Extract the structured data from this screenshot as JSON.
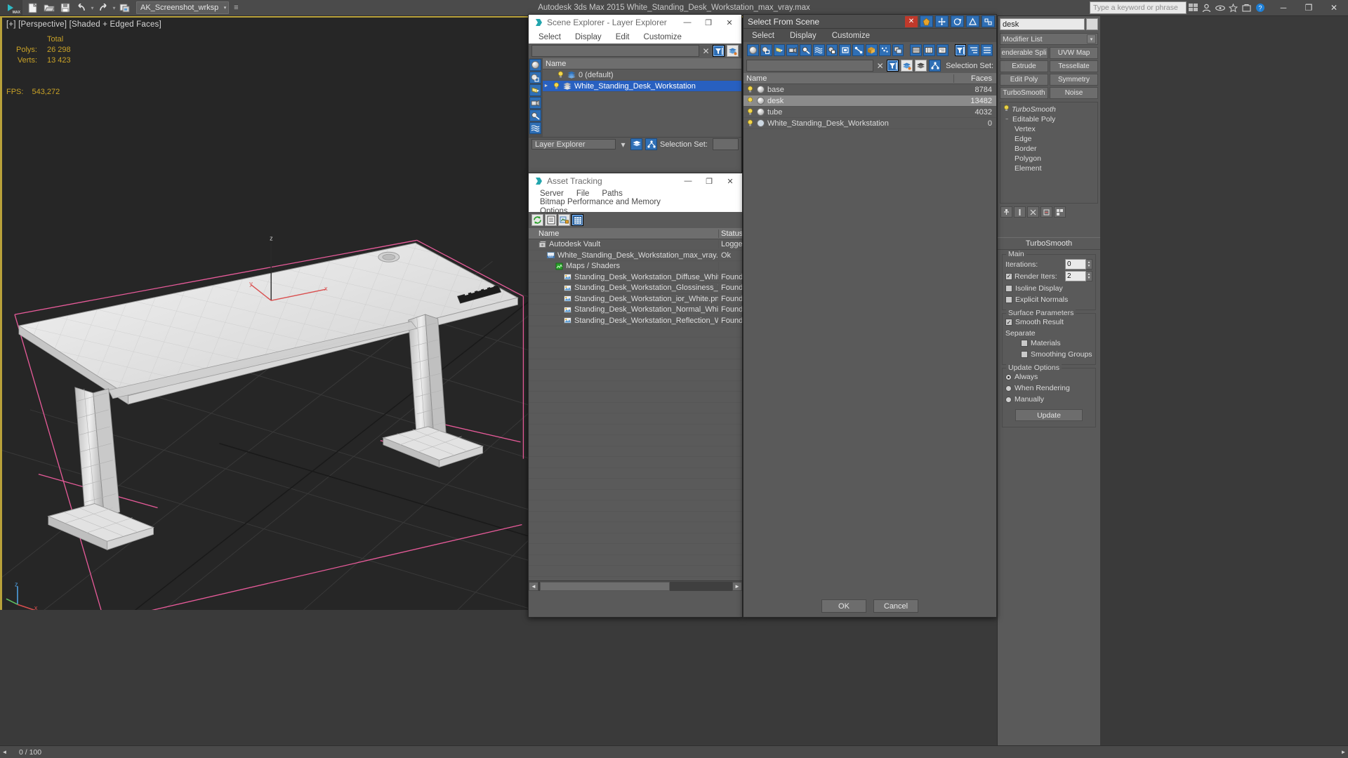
{
  "titlebar": {
    "logo_label": "MAX",
    "workspace": "AK_Screenshot_wrksp",
    "app_title": "Autodesk 3ds Max  2015      White_Standing_Desk_Workstation_max_vray.max",
    "search_placeholder": "Type a keyword or phrase",
    "quick_access": [
      {
        "name": "new-file-icon",
        "glyph": "⬜"
      },
      {
        "name": "open-file-icon",
        "glyph": "📂"
      },
      {
        "name": "save-file-icon",
        "glyph": "💾"
      },
      {
        "name": "undo-icon",
        "glyph": "↶"
      },
      {
        "name": "redo-icon",
        "glyph": "↷"
      },
      {
        "name": "project-folder-icon",
        "glyph": "🗂"
      }
    ],
    "window_buttons": [
      "─",
      "❐",
      "✕"
    ]
  },
  "viewport": {
    "label": "[+] [Perspective] [Shaded + Edged Faces]",
    "stats": {
      "header": "Total",
      "rows": [
        {
          "label": "Polys:",
          "value": "26 298"
        },
        {
          "label": "Verts:",
          "value": "13 423"
        }
      ],
      "fps_label": "FPS:",
      "fps_value": "543,272"
    }
  },
  "scene_explorer": {
    "title": "Scene Explorer - Layer Explorer",
    "menus": [
      "Select",
      "Display",
      "Edit",
      "Customize"
    ],
    "column_name": "Name",
    "rows": [
      {
        "name": "0 (default)",
        "selected": false,
        "expandable": false
      },
      {
        "name": "White_Standing_Desk_Workstation",
        "selected": true,
        "expandable": true
      }
    ],
    "footer_label": "Layer Explorer",
    "selection_set_label": "Selection Set:"
  },
  "asset_tracking": {
    "title": "Asset Tracking",
    "menus": [
      "Server",
      "File",
      "Paths",
      "Bitmap Performance and Memory",
      "Options"
    ],
    "columns": [
      "Name",
      "Status"
    ],
    "rows": [
      {
        "name": "Autodesk Vault",
        "status": "Logge",
        "icon": "vault-icon",
        "indent": 0
      },
      {
        "name": "White_Standing_Desk_Workstation_max_vray.max",
        "status": "Ok",
        "icon": "max-file-icon",
        "indent": 1
      },
      {
        "name": "Maps / Shaders",
        "status": "",
        "icon": "maps-icon",
        "indent": 2
      },
      {
        "name": "Standing_Desk_Workstation_Diffuse_White...",
        "status": "Found",
        "icon": "bitmap-icon",
        "indent": 3
      },
      {
        "name": "Standing_Desk_Workstation_Glossiness_W...",
        "status": "Found",
        "icon": "bitmap-icon",
        "indent": 3
      },
      {
        "name": "Standing_Desk_Workstation_ior_White.png",
        "status": "Found",
        "icon": "bitmap-icon",
        "indent": 3
      },
      {
        "name": "Standing_Desk_Workstation_Normal_Whit...",
        "status": "Found",
        "icon": "bitmap-icon",
        "indent": 3
      },
      {
        "name": "Standing_Desk_Workstation_Reflection_W...",
        "status": "Found",
        "icon": "bitmap-icon",
        "indent": 3
      }
    ],
    "empty_row_count": 25
  },
  "select_from_scene": {
    "title": "Select From Scene",
    "menus": [
      "Select",
      "Display",
      "Customize"
    ],
    "selection_set_label": "Selection Set:",
    "columns": [
      "Name",
      "Faces"
    ],
    "rows": [
      {
        "name": "base",
        "faces": "8784",
        "highlight": false
      },
      {
        "name": "desk",
        "faces": "13482",
        "highlight": true
      },
      {
        "name": "tube",
        "faces": "4032",
        "highlight": false
      },
      {
        "name": "White_Standing_Desk_Workstation",
        "faces": "0",
        "highlight": false
      }
    ],
    "ok_label": "OK",
    "cancel_label": "Cancel"
  },
  "command_panel": {
    "object_name": "desk",
    "modifier_list_label": "Modifier List",
    "modifier_buttons": [
      [
        "enderable Spli",
        "UVW Map"
      ],
      [
        "Extrude",
        "Tessellate"
      ],
      [
        "Edit Poly",
        "Symmetry"
      ],
      [
        "TurboSmooth",
        "Noise"
      ]
    ],
    "stack": [
      {
        "label": "TurboSmooth",
        "indent": 0,
        "italic": true
      },
      {
        "label": "Editable Poly",
        "indent": 0,
        "italic": false,
        "expander": "-"
      },
      {
        "label": "Vertex",
        "indent": 1,
        "italic": false
      },
      {
        "label": "Edge",
        "indent": 1,
        "italic": false
      },
      {
        "label": "Border",
        "indent": 1,
        "italic": false
      },
      {
        "label": "Polygon",
        "indent": 1,
        "italic": false
      },
      {
        "label": "Element",
        "indent": 1,
        "italic": false
      }
    ],
    "rollout_title": "TurboSmooth",
    "main_group": "Main",
    "iterations_label": "Iterations:",
    "iterations_value": "0",
    "render_iters_label": "Render Iters:",
    "render_iters_value": "2",
    "isoline_label": "Isoline Display",
    "isoline_checked": false,
    "explicit_label": "Explicit Normals",
    "explicit_checked": false,
    "surface_group": "Surface Parameters",
    "smooth_result_label": "Smooth Result",
    "smooth_result_checked": true,
    "separate_label": "Separate",
    "materials_label": "Materials",
    "materials_checked": false,
    "smoothing_groups_label": "Smoothing Groups",
    "smoothing_groups_checked": false,
    "update_group": "Update Options",
    "update_options": [
      {
        "label": "Always",
        "selected": true
      },
      {
        "label": "When Rendering",
        "selected": false
      },
      {
        "label": "Manually",
        "selected": false
      }
    ],
    "update_button": "Update"
  },
  "status_bar": {
    "frame_counter": "0 / 100"
  },
  "colors": {
    "accent_blue": "#2860c0",
    "viewport_border": "#b8a13a",
    "stat_text": "#c9a227",
    "selection_pink": "#e85b9a",
    "panel_bg": "#5a5a5a"
  }
}
